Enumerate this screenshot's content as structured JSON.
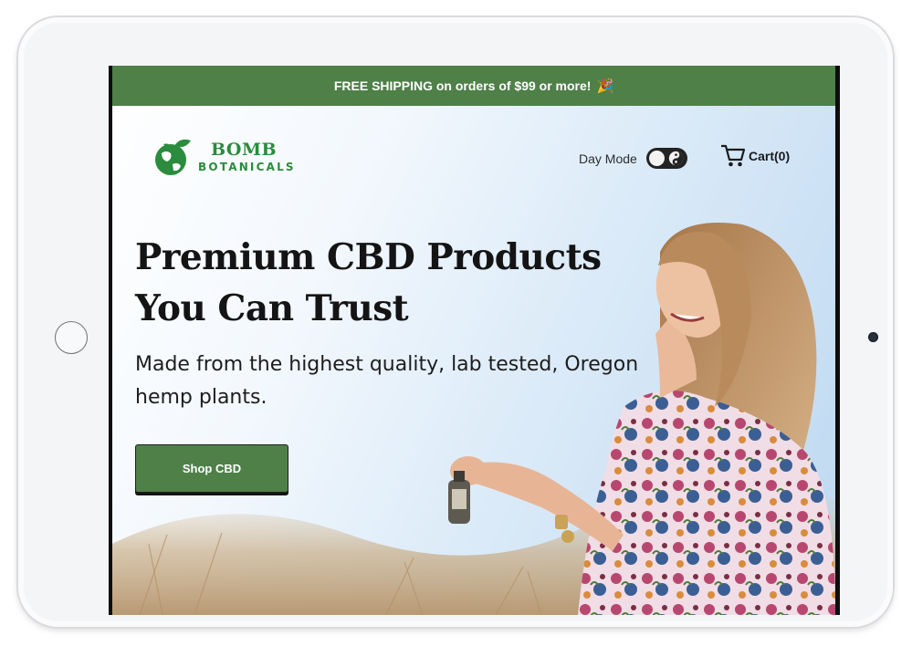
{
  "announcement": {
    "text": "FREE SHIPPING on orders of $99 or more!",
    "emoji": "🎉"
  },
  "logo": {
    "line1": "BOMB",
    "line2": "BOTANICALS"
  },
  "header": {
    "day_mode_label": "Day Mode",
    "cart_label": "Cart(0)"
  },
  "hero": {
    "headline": "Premium CBD Products You Can Trust",
    "subtext": "Made from the highest quality, lab tested, Oregon hemp plants.",
    "cta_label": "Shop CBD"
  },
  "colors": {
    "brand_green": "#4e8048",
    "logo_green": "#2a8c3c"
  },
  "icons": [
    "globe-leaf-logo-icon",
    "yin-yang-icon",
    "cart-icon",
    "party-popper-icon"
  ]
}
